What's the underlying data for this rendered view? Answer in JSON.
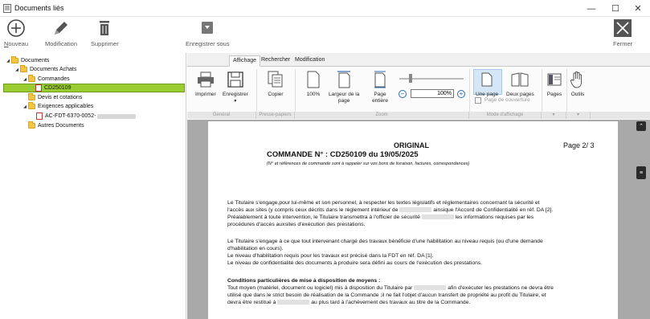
{
  "window": {
    "title": "Documents liés",
    "minimize_glyph": "—",
    "maximize_glyph": "☐",
    "close_glyph": "✕"
  },
  "toolbar": {
    "new_label_prefix": "N",
    "new_label_rest": "ouveau",
    "modify_label": "Modification",
    "delete_label": "Supprimer",
    "save_as_label": "Enregistrer sous",
    "close_label": "Fermer"
  },
  "tree": {
    "items": [
      {
        "label": "Documents",
        "expander": "◢"
      },
      {
        "label": "Documents Achats",
        "expander": "◢"
      },
      {
        "label": "Commandes",
        "expander": "◢"
      },
      {
        "label": "CD250109",
        "expander": ""
      },
      {
        "label": "Devis et cotations",
        "expander": ""
      },
      {
        "label": "Exigences applicables",
        "expander": "◢"
      },
      {
        "label": "AC-FDT-6370-0052-",
        "expander": ""
      },
      {
        "label": "Autres Documents",
        "expander": ""
      }
    ]
  },
  "ribbon": {
    "tabs": [
      "Affichage",
      "Rechercher",
      "Modification"
    ],
    "buttons": {
      "print": "Imprimer",
      "save": "Enregistrer",
      "copy": "Copier",
      "zoom100": "100%",
      "page_width_l1": "Largeur de la",
      "page_width_l2": "page",
      "whole_page_l1": "Page",
      "whole_page_l2": "entière",
      "one_page": "Une page",
      "two_pages": "Deux pages",
      "cover_page": "Page de couverture",
      "pages": "Pages",
      "tools": "Outils"
    },
    "zoom_value": "100%",
    "groups": {
      "general": "Général",
      "clipboard": "Presse-papiers",
      "zoom": "Zoom",
      "view_mode": "Mode d'affichage"
    }
  },
  "document": {
    "original": "ORIGINAL",
    "page_indicator": "Page 2/ 3",
    "order_title": "COMMANDE N° : CD250109 du 19/05/2025",
    "subtitle": "(N° et références de commande sont à rappeler sur vos bons de livraison, factures, correspondances)",
    "para1": [
      "Le Titulaire s'engage,pour lui-même et son personnel, à respecter les textes législatifs et réglementaires concernant la sécurité et",
      [
        "l'accès aux sites (y compris ceux décrits dans le règlement intérieur de ",
        " ainsique l'Accord de Confidentialité en réf. DA [2]."
      ],
      [
        "Préalablement à toute intervention, le Titulaire transmettra à l'officier de sécurité ",
        " les informations requises par les"
      ],
      "procédures d'accès auxsites d'exécution des prestations."
    ],
    "para2": [
      "Le Titulaire s'engage à ce que tout intervenant chargé des travaux bénéficie d'une habilitation au niveau requis (ou d'une demande",
      "d'habilitation en cours).",
      "Le niveau d'habilitation requis pour les travaux est précisé dans la FDT en réf. DA [1].",
      "Le niveau de confidentialité des documents à produire sera défini au cours de l'exécution des prestations."
    ],
    "conditions_title": "Conditions particulières de mise à disposition de moyens :",
    "para3": [
      [
        "Tout moyen (matériel, document ou logiciel) mis à disposition du Titulaire par ",
        " afin d'exécuter les prestations ne devra être"
      ],
      "utilisé que dans le strict besoin de réalisation de la Commande ;il ne fait l'objet d'aucun transfert de propriété au profit du Titulaire, et",
      [
        "devra être restitué à ",
        " au plus tard à l'achèvement des travaux au titre de la Commande."
      ]
    ]
  }
}
